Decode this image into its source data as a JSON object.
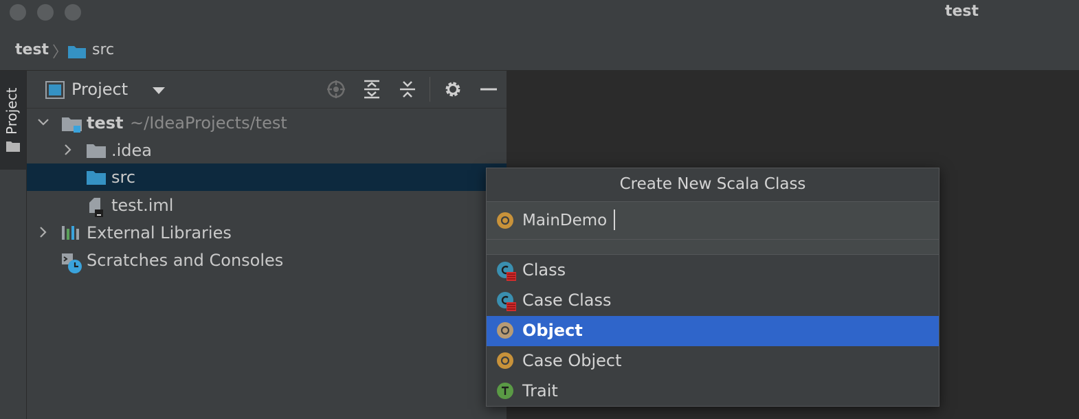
{
  "window": {
    "title": "test"
  },
  "breadcrumb": {
    "root": "test",
    "separator": "〉",
    "current": "src"
  },
  "left_strip": {
    "tab_label": "Project"
  },
  "project_panel": {
    "title": "Project",
    "toolbar": [
      "locate-icon",
      "expand-all-icon",
      "collapse-all-icon",
      "gear-icon",
      "minimize-icon"
    ],
    "tree": {
      "root": {
        "label": "test",
        "hint": "~/IdeaProjects/test"
      },
      "idea": {
        "label": ".idea"
      },
      "src": {
        "label": "src"
      },
      "iml": {
        "label": "test.iml"
      },
      "external": {
        "label": "External Libraries"
      },
      "scratches": {
        "label": "Scratches and Consoles"
      }
    }
  },
  "dialog": {
    "title": "Create New Scala Class",
    "name_value": "MainDemo",
    "kinds": [
      {
        "label": "Class",
        "icon": "scala-class-icon"
      },
      {
        "label": "Case Class",
        "icon": "scala-case-class-icon"
      },
      {
        "label": "Object",
        "icon": "scala-object-icon",
        "selected": true
      },
      {
        "label": "Case Object",
        "icon": "scala-case-object-icon"
      },
      {
        "label": "Trait",
        "icon": "scala-trait-icon"
      }
    ]
  },
  "colors": {
    "selection": "#2f65ca",
    "tree_selection": "#0d293e",
    "folder": "#3592c4",
    "object": "#c8923a",
    "trait": "#5a9a45"
  }
}
